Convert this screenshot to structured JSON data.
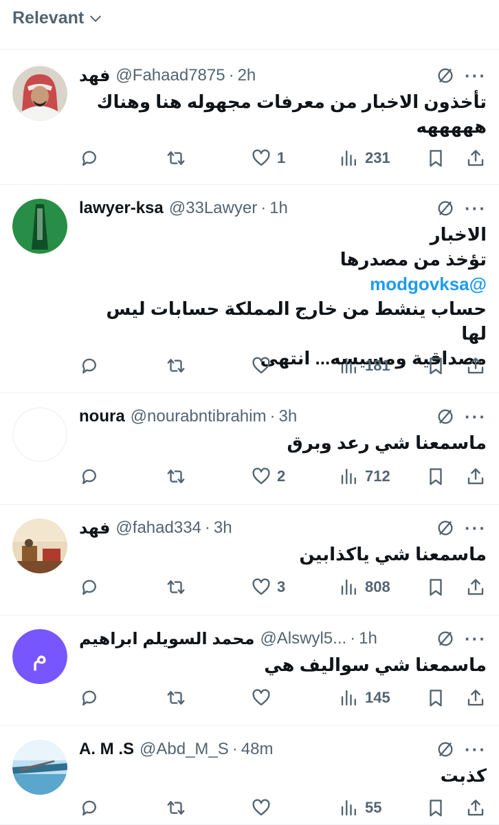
{
  "sort": {
    "label": "Relevant"
  },
  "tweets": [
    {
      "name": "فهد",
      "handle": "@Fahaad7875",
      "time": "2h",
      "lines": [
        "تأخذون الاخبار من معرفات مجهوله هنا وهناك",
        "هههههه"
      ],
      "likes": "1",
      "views": "231"
    },
    {
      "name": "lawyer-ksa",
      "handle": "@33Lawyer",
      "time": "1h",
      "lines": [
        "الاخبار",
        "تؤخذ من مصدرها",
        "@modgovksa",
        "حساب ينشط من خارج المملكة حسابات ليس لها",
        "مصداقية ومسيسه... انتهى"
      ],
      "likes": "",
      "views": "181"
    },
    {
      "name": "noura",
      "handle": "@nourabntibrahim",
      "time": "3h",
      "lines": [
        "ماسمعنا شي رعد وبرق"
      ],
      "likes": "2",
      "views": "712"
    },
    {
      "name": "فهد",
      "handle": "@fahad334",
      "time": "3h",
      "lines": [
        "ماسمعنا شي ياكذابين"
      ],
      "likes": "3",
      "views": "808"
    },
    {
      "name": "محمد السويلم ابراهيم",
      "handle": "@Alswyl5...",
      "time": "1h",
      "lines": [
        "ماسمعنا شي سواليف هي"
      ],
      "likes": "",
      "views": "145",
      "avatar_letter": "م"
    },
    {
      "name": "A. M .S",
      "handle": "@Abd_M_S",
      "time": "48m",
      "lines": [
        "كذبت"
      ],
      "likes": "",
      "views": "55"
    }
  ],
  "colors": {
    "accent": "#1d9bf0",
    "secondary_text": "#536471",
    "divider": "#eff3f4",
    "avatar_purple": "#7856ff"
  }
}
